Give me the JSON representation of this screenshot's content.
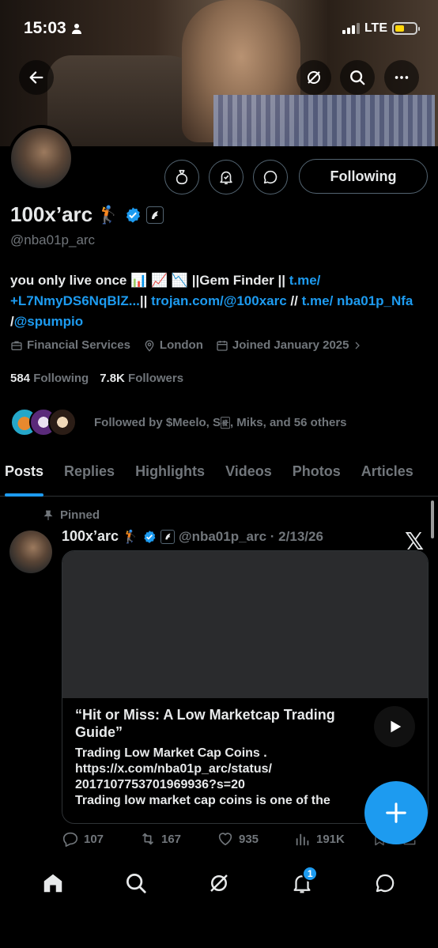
{
  "status_bar": {
    "time": "15:03",
    "network": "LTE",
    "battery_level": 0.45
  },
  "profile": {
    "name": "100x’arc",
    "name_emoji": "🏌️",
    "handle": "@nba01p_arc",
    "bio_text": "you only live once 📊 📈 📉 ||Gem Finder || ",
    "bio_link1": "t.me/ +L7NmyDS6NqBlZ...",
    "bio_sep1": "|| ",
    "bio_link2": "trojan.com/@100xarc",
    "bio_sep2": " // ",
    "bio_link3": "t.me/ nba01p_Nfa",
    "bio_sep3": " /",
    "bio_link4": "@spumpio",
    "category": "Financial Services",
    "location": "London",
    "joined": "Joined January 2025",
    "following_count": "584",
    "following_label": "Following",
    "followers_count": "7.8K",
    "followers_label": "Followers",
    "followed_by": "Followed by $Meelo, S🀅, Miks, and 56 others",
    "follow_button": "Following"
  },
  "tabs": [
    "Posts",
    "Replies",
    "Highlights",
    "Videos",
    "Photos",
    "Articles"
  ],
  "pinned_post": {
    "pinned_label": "Pinned",
    "author": "100x’arc",
    "author_emoji": "🏌️",
    "meta": "@nba01p_arc · 2/13/26",
    "card_title": "“Hit or Miss: A Low Marketcap Trading Guide”",
    "card_line1": "Trading Low Market Cap Coins .",
    "card_line2": "https://x.com/nba01p_arc/status/",
    "card_line3": "2017107753701969936?s=20",
    "card_line4": " Trading low market cap coins is one of the",
    "replies": "107",
    "reposts": "167",
    "likes": "935",
    "views": "191K"
  },
  "nav": {
    "notification_badge": "1"
  },
  "colors": {
    "accent": "#1d9bf0",
    "muted": "#71767b",
    "text": "#e7e9ea",
    "background": "#000000"
  }
}
